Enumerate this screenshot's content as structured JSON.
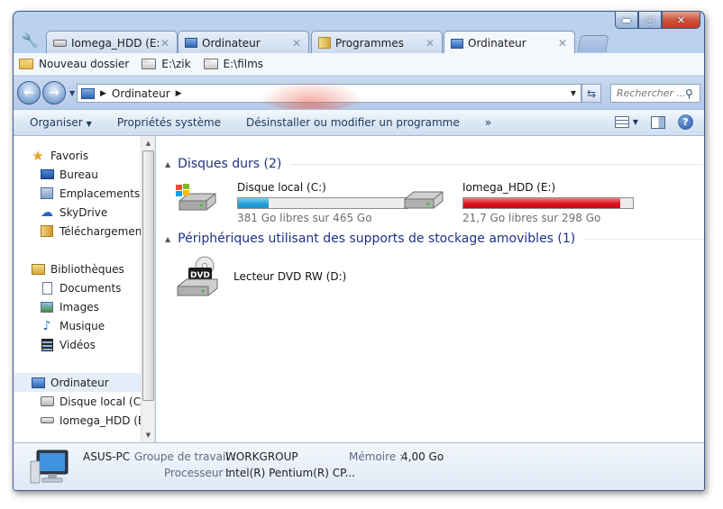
{
  "tabs": [
    {
      "label": "Iomega_HDD (E:)",
      "icon": "drive-icon"
    },
    {
      "label": "Ordinateur",
      "icon": "computer-icon"
    },
    {
      "label": "Programmes",
      "icon": "folder-icon"
    },
    {
      "label": "Ordinateur",
      "icon": "computer-icon",
      "active": true
    }
  ],
  "bookmarks": [
    {
      "label": "Nouveau dossier"
    },
    {
      "label": "E:\\zik"
    },
    {
      "label": "E:\\films"
    }
  ],
  "address": {
    "segment": "Ordinateur"
  },
  "search": {
    "placeholder": "Rechercher ..."
  },
  "commands": {
    "organize": "Organiser",
    "system_properties": "Propriétés système",
    "uninstall": "Désinstaller ou modifier un programme",
    "more": "»"
  },
  "nav": {
    "favorites": "Favoris",
    "desktop": "Bureau",
    "recent_places": "Emplacements ré",
    "skydrive": "SkyDrive",
    "downloads": "Téléchargements",
    "libraries": "Bibliothèques",
    "documents": "Documents",
    "images": "Images",
    "music": "Musique",
    "videos": "Vidéos",
    "computer": "Ordinateur",
    "local_disk": "Disque local (C:)",
    "iomega": "Iomega_HDD (E:)"
  },
  "groups": {
    "hard_disks": "Disques durs (2)",
    "removable": "Périphériques utilisant des supports de stockage amovibles (1)"
  },
  "drives": [
    {
      "name": "Disque local (C:)",
      "free": "381 Go libres sur 465 Go",
      "used_fraction": 0.18,
      "color": "#26a0da"
    },
    {
      "name": "Iomega_HDD (E:)",
      "free": "21,7 Go libres sur 298 Go",
      "used_fraction": 0.927,
      "color": "#d9121b"
    }
  ],
  "dvd": {
    "name": "Lecteur DVD RW (D:)",
    "badge": "DVD"
  },
  "details": {
    "pc_name": "ASUS-PC",
    "workgroup_label": "Groupe de travail :",
    "workgroup": "WORKGROUP",
    "memory_label": "Mémoire :",
    "memory": "4,00 Go",
    "processor_label": "Processeur :",
    "processor": "Intel(R) Pentium(R) CP..."
  }
}
